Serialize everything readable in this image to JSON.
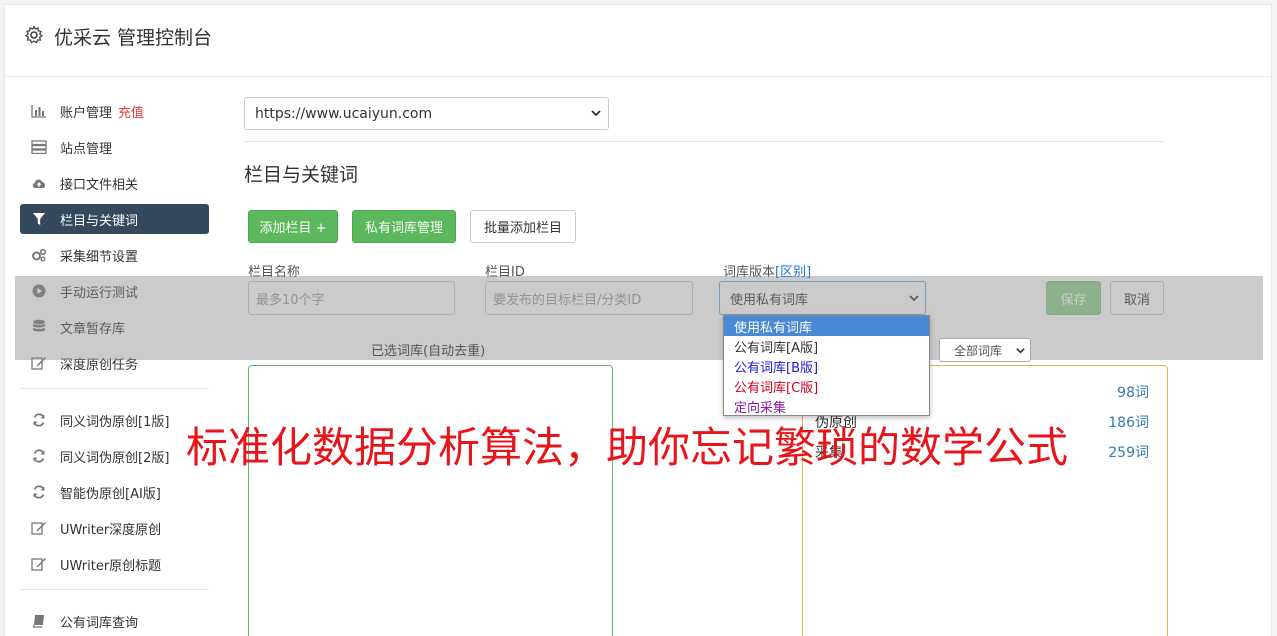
{
  "header": {
    "title": "优采云 管理控制台",
    "icon": "gear-icon"
  },
  "sidebar": {
    "items": [
      {
        "label": "账户管理",
        "extra": "充值",
        "icon": "bar-chart-icon"
      },
      {
        "label": "站点管理",
        "icon": "server-icon"
      },
      {
        "label": "接口文件相关",
        "icon": "cloud-upload-icon"
      },
      {
        "label": "栏目与关键词",
        "icon": "filter-icon",
        "active": true
      },
      {
        "label": "采集细节设置",
        "icon": "cogs-icon"
      },
      {
        "label": "手动运行测试",
        "icon": "play-circle-icon"
      },
      {
        "label": "文章暂存库",
        "icon": "database-icon"
      },
      {
        "label": "深度原创任务",
        "icon": "edit-icon"
      },
      {
        "label": "同义词伪原创[1版]",
        "icon": "refresh-icon"
      },
      {
        "label": "同义词伪原创[2版]",
        "icon": "refresh-icon"
      },
      {
        "label": "智能伪原创[AI版]",
        "icon": "refresh-icon"
      },
      {
        "label": "UWriter深度原创",
        "icon": "edit-icon"
      },
      {
        "label": "UWriter原创标题",
        "icon": "edit-icon"
      },
      {
        "label": "公有词库查询",
        "icon": "book-icon"
      }
    ]
  },
  "main": {
    "site_select": "https://www.ucaiyun.com",
    "section_title": "栏目与关键词",
    "buttons": {
      "add_column": "添加栏目 +",
      "private_lib": "私有词库管理",
      "batch_add": "批量添加栏目"
    },
    "form": {
      "name_label": "栏目名称",
      "name_placeholder": "最多10个字",
      "id_label": "栏目ID",
      "id_placeholder": "要发布的目标栏目/分类ID",
      "version_label": "词库版本",
      "version_link": "[区别]",
      "version_value": "使用私有词库",
      "save": "保存",
      "cancel": "取消"
    },
    "selected_label": "已选词库(自动去重)",
    "all_lib_select": "全部词库",
    "dropdown_options": [
      {
        "label": "使用私有词库",
        "color": "#ffffff",
        "selected": true
      },
      {
        "label": "公有词库[A版]",
        "color": "#333333"
      },
      {
        "label": "公有词库[B版]",
        "color": "#1a1adb"
      },
      {
        "label": "公有词库[C版]",
        "color": "#d0021b"
      },
      {
        "label": "定向采集",
        "color": "#8b1aa8"
      }
    ],
    "library_rows": [
      {
        "name": "",
        "count": "98词"
      },
      {
        "name": "伪原创",
        "count": "186词"
      },
      {
        "name": "采集",
        "count": "259词"
      }
    ]
  },
  "banner": "标准化数据分析算法，助你忘记繁琐的数学公式",
  "colors": {
    "accent_green": "#5cb85c",
    "sidebar_active": "#34495e",
    "banner_red": "#e8141a",
    "link_blue": "#337ab7"
  }
}
